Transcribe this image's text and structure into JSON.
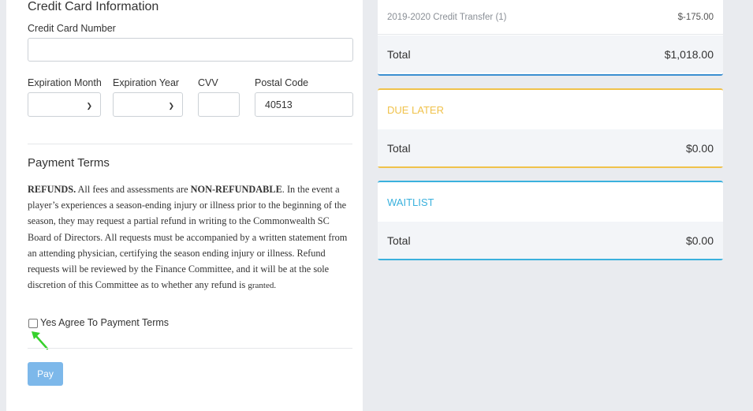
{
  "credit_card": {
    "section_title": "Credit Card Information",
    "card_number_label": "Credit Card Number",
    "card_number_value": "",
    "exp_month_label": "Expiration Month",
    "exp_month_value": "",
    "exp_year_label": "Expiration Year",
    "exp_year_value": "",
    "cvv_label": "CVV",
    "cvv_value": "",
    "postal_label": "Postal Code",
    "postal_value": "40513"
  },
  "payment_terms": {
    "title": "Payment Terms",
    "refunds_lead": "REFUNDS.",
    "text_a": " All fees and assessments are ",
    "non_refundable": "NON-REFUNDABLE",
    "text_b": ". In the event a player’s experiences a season-ending injury or illness prior to the beginning of the season, they may request a partial refund in writing to the Commonwealth SC Board of Directors. All requests must be accompanied by a written statement from an attending physician, certifying the season ending injury or illness. Refund requests will be reviewed by the Finance Committee, and it will be at the sole discretion of this Committee as to whether any refund is ",
    "text_small": "granted.",
    "agree_label": "Yes Agree To Payment Terms",
    "agree_checked": false
  },
  "pay_button": "Pay",
  "summary": {
    "line_item_label": "2019-2020 Credit Transfer (1)",
    "line_item_amount": "$-175.00",
    "total_label": "Total",
    "total_amount": "$1,018.00",
    "due_later": {
      "title": "DUE LATER",
      "total_label": "Total",
      "total_amount": "$0.00",
      "accent": "#f0c24b"
    },
    "waitlist": {
      "title": "WAITLIST",
      "total_label": "Total",
      "total_amount": "$0.00",
      "accent": "#3ab1dd"
    },
    "primary_accent": "#3b8fd1"
  },
  "annotation": {
    "arrow_color": "#36d12b",
    "icon": "green-arrow-icon"
  }
}
